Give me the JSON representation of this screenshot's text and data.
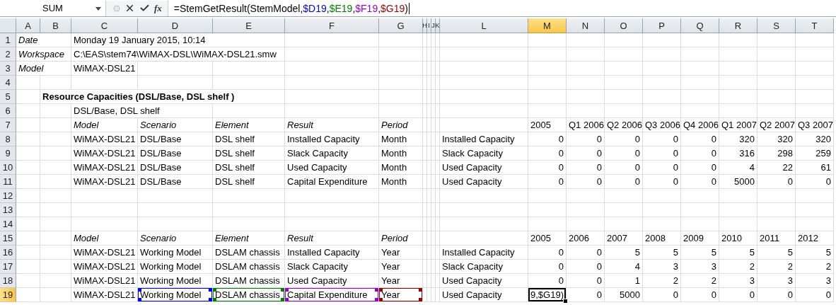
{
  "formula_bar": {
    "name_box": "SUM",
    "function_label": "fx",
    "formula": [
      {
        "text": "=StemGetResult(StemModel,"
      },
      {
        "text": "$D19",
        "color": "#0000ff"
      },
      {
        "text": ","
      },
      {
        "text": "$E19",
        "color": "#008000"
      },
      {
        "text": ","
      },
      {
        "text": "$F19",
        "color": "#9900cc"
      },
      {
        "text": ","
      },
      {
        "text": "$G19",
        "color": "#990000"
      },
      {
        "text": ")"
      }
    ]
  },
  "columns": [
    {
      "label": "A",
      "selected": false
    },
    {
      "label": "B",
      "selected": false
    },
    {
      "label": "C",
      "selected": false
    },
    {
      "label": "D",
      "selected": false
    },
    {
      "label": "E",
      "selected": false
    },
    {
      "label": "F",
      "selected": false
    },
    {
      "label": "G",
      "selected": false
    },
    {
      "label": "H",
      "selected": false
    },
    {
      "label": "I",
      "selected": false
    },
    {
      "label": "J",
      "selected": false
    },
    {
      "label": "K",
      "selected": false
    },
    {
      "label": "L",
      "selected": false
    },
    {
      "label": "M",
      "selected": true
    },
    {
      "label": "N",
      "selected": false
    },
    {
      "label": "O",
      "selected": false
    },
    {
      "label": "P",
      "selected": false
    },
    {
      "label": "Q",
      "selected": false
    },
    {
      "label": "R",
      "selected": false
    },
    {
      "label": "S",
      "selected": false
    },
    {
      "label": "T",
      "selected": false
    }
  ],
  "rows": [
    {
      "number": "1",
      "selected": false,
      "cells": {
        "A": {
          "text": "Date",
          "kind": "italic",
          "selected": false
        },
        "C": {
          "text": "Monday 19 January 2015, 10:14",
          "kind": "text",
          "selected": false
        }
      }
    },
    {
      "number": "2",
      "selected": false,
      "cells": {
        "A": {
          "text": "Workspace",
          "kind": "italic",
          "selected": false
        },
        "C": {
          "text": "C:\\EAS\\stem74\\WiMAX-DSL\\WiMAX-DSL21.smw",
          "kind": "text",
          "selected": false
        }
      }
    },
    {
      "number": "3",
      "selected": false,
      "cells": {
        "A": {
          "text": "Model",
          "kind": "italic",
          "selected": false
        },
        "C": {
          "text": "WiMAX-DSL21",
          "kind": "text",
          "selected": false
        }
      }
    },
    {
      "number": "4",
      "selected": false,
      "cells": {}
    },
    {
      "number": "5",
      "selected": false,
      "cells": {
        "B": {
          "text": "Resource Capacities (DSL/Base, DSL shelf )",
          "kind": "bold",
          "selected": false
        }
      }
    },
    {
      "number": "6",
      "selected": false,
      "cells": {
        "C": {
          "text": "DSL/Base, DSL shelf",
          "kind": "text",
          "selected": false
        }
      }
    },
    {
      "number": "7",
      "selected": false,
      "cells": {
        "C": {
          "text": "Model",
          "kind": "italic",
          "selected": false
        },
        "D": {
          "text": "Scenario",
          "kind": "italic",
          "selected": false
        },
        "E": {
          "text": "Element",
          "kind": "italic",
          "selected": false
        },
        "F": {
          "text": "Result",
          "kind": "italic",
          "selected": false
        },
        "G": {
          "text": "Period",
          "kind": "italic",
          "selected": false
        },
        "M": {
          "text": "2005",
          "kind": "text",
          "selected": false
        },
        "N": {
          "text": "Q1 2006",
          "kind": "text",
          "selected": false
        },
        "O": {
          "text": "Q2 2006",
          "kind": "text",
          "selected": false
        },
        "P": {
          "text": "Q3 2006",
          "kind": "text",
          "selected": false
        },
        "Q": {
          "text": "Q4 2006",
          "kind": "text",
          "selected": false
        },
        "R": {
          "text": "Q1 2007",
          "kind": "text",
          "selected": false
        },
        "S": {
          "text": "Q2 2007",
          "kind": "text",
          "selected": false
        },
        "T": {
          "text": "Q3 2007",
          "kind": "text",
          "selected": false
        }
      }
    },
    {
      "number": "8",
      "selected": false,
      "cells": {
        "C": {
          "text": "WiMAX-DSL21",
          "kind": "text",
          "selected": false
        },
        "D": {
          "text": "DSL/Base",
          "kind": "text",
          "selected": false
        },
        "E": {
          "text": "DSL shelf",
          "kind": "text",
          "selected": false
        },
        "F": {
          "text": "Installed Capacity",
          "kind": "text",
          "selected": false
        },
        "G": {
          "text": "Month",
          "kind": "text",
          "selected": false
        },
        "L": {
          "text": "Installed Capacity",
          "kind": "text",
          "selected": false
        },
        "M": {
          "text": "0",
          "kind": "number",
          "selected": false
        },
        "N": {
          "text": "0",
          "kind": "number",
          "selected": false
        },
        "O": {
          "text": "0",
          "kind": "number",
          "selected": false
        },
        "P": {
          "text": "0",
          "kind": "number",
          "selected": false
        },
        "Q": {
          "text": "0",
          "kind": "number",
          "selected": false
        },
        "R": {
          "text": "320",
          "kind": "number",
          "selected": false
        },
        "S": {
          "text": "320",
          "kind": "number",
          "selected": false
        },
        "T": {
          "text": "320",
          "kind": "number",
          "selected": false
        }
      }
    },
    {
      "number": "9",
      "selected": false,
      "cells": {
        "C": {
          "text": "WiMAX-DSL21",
          "kind": "text",
          "selected": false
        },
        "D": {
          "text": "DSL/Base",
          "kind": "text",
          "selected": false
        },
        "E": {
          "text": "DSL shelf",
          "kind": "text",
          "selected": false
        },
        "F": {
          "text": "Slack Capacity",
          "kind": "text",
          "selected": false
        },
        "G": {
          "text": "Month",
          "kind": "text",
          "selected": false
        },
        "L": {
          "text": "Slack Capacity",
          "kind": "text",
          "selected": false
        },
        "M": {
          "text": "0",
          "kind": "number",
          "selected": false
        },
        "N": {
          "text": "0",
          "kind": "number",
          "selected": false
        },
        "O": {
          "text": "0",
          "kind": "number",
          "selected": false
        },
        "P": {
          "text": "0",
          "kind": "number",
          "selected": false
        },
        "Q": {
          "text": "0",
          "kind": "number",
          "selected": false
        },
        "R": {
          "text": "316",
          "kind": "number",
          "selected": false
        },
        "S": {
          "text": "298",
          "kind": "number",
          "selected": false
        },
        "T": {
          "text": "259",
          "kind": "number",
          "selected": false
        }
      }
    },
    {
      "number": "10",
      "selected": false,
      "cells": {
        "C": {
          "text": "WiMAX-DSL21",
          "kind": "text",
          "selected": false
        },
        "D": {
          "text": "DSL/Base",
          "kind": "text",
          "selected": false
        },
        "E": {
          "text": "DSL shelf",
          "kind": "text",
          "selected": false
        },
        "F": {
          "text": "Used Capacity",
          "kind": "text",
          "selected": false
        },
        "G": {
          "text": "Month",
          "kind": "text",
          "selected": false
        },
        "L": {
          "text": "Used Capacity",
          "kind": "text",
          "selected": false
        },
        "M": {
          "text": "0",
          "kind": "number",
          "selected": false
        },
        "N": {
          "text": "0",
          "kind": "number",
          "selected": false
        },
        "O": {
          "text": "0",
          "kind": "number",
          "selected": false
        },
        "P": {
          "text": "0",
          "kind": "number",
          "selected": false
        },
        "Q": {
          "text": "0",
          "kind": "number",
          "selected": false
        },
        "R": {
          "text": "4",
          "kind": "number",
          "selected": false
        },
        "S": {
          "text": "22",
          "kind": "number",
          "selected": false
        },
        "T": {
          "text": "61",
          "kind": "number",
          "selected": false
        }
      }
    },
    {
      "number": "11",
      "selected": false,
      "cells": {
        "C": {
          "text": "WiMAX-DSL21",
          "kind": "text",
          "selected": false
        },
        "D": {
          "text": "DSL/Base",
          "kind": "text",
          "selected": false
        },
        "E": {
          "text": "DSL shelf",
          "kind": "text",
          "selected": false
        },
        "F": {
          "text": "Capital Expenditure",
          "kind": "text",
          "selected": false
        },
        "G": {
          "text": "Month",
          "kind": "text",
          "selected": false
        },
        "L": {
          "text": "Used Capacity",
          "kind": "text",
          "selected": false
        },
        "M": {
          "text": "0",
          "kind": "number",
          "selected": false
        },
        "N": {
          "text": "0",
          "kind": "number",
          "selected": false
        },
        "O": {
          "text": "0",
          "kind": "number",
          "selected": false
        },
        "P": {
          "text": "0",
          "kind": "number",
          "selected": false
        },
        "Q": {
          "text": "0",
          "kind": "number",
          "selected": false
        },
        "R": {
          "text": "5000",
          "kind": "number",
          "selected": false
        },
        "S": {
          "text": "0",
          "kind": "number",
          "selected": false
        },
        "T": {
          "text": "0",
          "kind": "number",
          "selected": false
        }
      }
    },
    {
      "number": "12",
      "selected": false,
      "cells": {}
    },
    {
      "number": "13",
      "selected": false,
      "cells": {}
    },
    {
      "number": "14",
      "selected": false,
      "cells": {}
    },
    {
      "number": "15",
      "selected": false,
      "cells": {
        "C": {
          "text": "Model",
          "kind": "italic",
          "selected": false
        },
        "D": {
          "text": "Scenario",
          "kind": "italic",
          "selected": false
        },
        "E": {
          "text": "Element",
          "kind": "italic",
          "selected": false
        },
        "F": {
          "text": "Result",
          "kind": "italic",
          "selected": false
        },
        "G": {
          "text": "Period",
          "kind": "italic",
          "selected": false
        },
        "M": {
          "text": "2005",
          "kind": "text",
          "selected": false
        },
        "N": {
          "text": "2006",
          "kind": "text",
          "selected": false
        },
        "O": {
          "text": "2007",
          "kind": "text",
          "selected": false
        },
        "P": {
          "text": "2008",
          "kind": "text",
          "selected": false
        },
        "Q": {
          "text": "2009",
          "kind": "text",
          "selected": false
        },
        "R": {
          "text": "2010",
          "kind": "text",
          "selected": false
        },
        "S": {
          "text": "2011",
          "kind": "text",
          "selected": false
        },
        "T": {
          "text": "2012",
          "kind": "text",
          "selected": false
        }
      }
    },
    {
      "number": "16",
      "selected": false,
      "cells": {
        "C": {
          "text": "WiMAX-DSL21",
          "kind": "text",
          "selected": false
        },
        "D": {
          "text": "Working Model",
          "kind": "text",
          "selected": false
        },
        "E": {
          "text": "DSLAM chassis",
          "kind": "text",
          "selected": false
        },
        "F": {
          "text": "Installed Capacity",
          "kind": "text",
          "selected": false
        },
        "G": {
          "text": "Year",
          "kind": "text",
          "selected": false
        },
        "L": {
          "text": "Installed Capacity",
          "kind": "text",
          "selected": false
        },
        "M": {
          "text": "0",
          "kind": "number",
          "selected": false
        },
        "N": {
          "text": "0",
          "kind": "number",
          "selected": false
        },
        "O": {
          "text": "5",
          "kind": "number",
          "selected": false
        },
        "P": {
          "text": "5",
          "kind": "number",
          "selected": false
        },
        "Q": {
          "text": "5",
          "kind": "number",
          "selected": false
        },
        "R": {
          "text": "5",
          "kind": "number",
          "selected": false
        },
        "S": {
          "text": "5",
          "kind": "number",
          "selected": false
        },
        "T": {
          "text": "5",
          "kind": "number",
          "selected": false
        }
      }
    },
    {
      "number": "17",
      "selected": false,
      "cells": {
        "C": {
          "text": "WiMAX-DSL21",
          "kind": "text",
          "selected": false
        },
        "D": {
          "text": "Working Model",
          "kind": "text",
          "selected": false
        },
        "E": {
          "text": "DSLAM chassis",
          "kind": "text",
          "selected": false
        },
        "F": {
          "text": "Slack Capacity",
          "kind": "text",
          "selected": false
        },
        "G": {
          "text": "Year",
          "kind": "text",
          "selected": false
        },
        "L": {
          "text": "Slack Capacity",
          "kind": "text",
          "selected": false
        },
        "M": {
          "text": "0",
          "kind": "number",
          "selected": false
        },
        "N": {
          "text": "0",
          "kind": "number",
          "selected": false
        },
        "O": {
          "text": "4",
          "kind": "number",
          "selected": false
        },
        "P": {
          "text": "3",
          "kind": "number",
          "selected": false
        },
        "Q": {
          "text": "3",
          "kind": "number",
          "selected": false
        },
        "R": {
          "text": "2",
          "kind": "number",
          "selected": false
        },
        "S": {
          "text": "2",
          "kind": "number",
          "selected": false
        },
        "T": {
          "text": "2",
          "kind": "number",
          "selected": false
        }
      }
    },
    {
      "number": "18",
      "selected": false,
      "cells": {
        "C": {
          "text": "WiMAX-DSL21",
          "kind": "text",
          "selected": false
        },
        "D": {
          "text": "Working Model",
          "kind": "text",
          "selected": false
        },
        "E": {
          "text": "DSLAM chassis",
          "kind": "text",
          "selected": false
        },
        "F": {
          "text": "Used Capacity",
          "kind": "text",
          "selected": false
        },
        "G": {
          "text": "Year",
          "kind": "text",
          "selected": false
        },
        "L": {
          "text": "Used Capacity",
          "kind": "text",
          "selected": false
        },
        "M": {
          "text": "0",
          "kind": "number",
          "selected": false
        },
        "N": {
          "text": "0",
          "kind": "number",
          "selected": false
        },
        "O": {
          "text": "1",
          "kind": "number",
          "selected": false
        },
        "P": {
          "text": "2",
          "kind": "number",
          "selected": false
        },
        "Q": {
          "text": "2",
          "kind": "number",
          "selected": false
        },
        "R": {
          "text": "3",
          "kind": "number",
          "selected": false
        },
        "S": {
          "text": "3",
          "kind": "number",
          "selected": false
        },
        "T": {
          "text": "3",
          "kind": "number",
          "selected": false
        }
      }
    },
    {
      "number": "19",
      "selected": true,
      "cells": {
        "C": {
          "text": "WiMAX-DSL21",
          "kind": "text",
          "selected": false
        },
        "D": {
          "text": "Working Model",
          "kind": "text",
          "selected": false,
          "color": "#0000ff"
        },
        "E": {
          "text": "DSLAM chassis",
          "kind": "text",
          "selected": false,
          "color": "#008000"
        },
        "F": {
          "text": "Capital Expenditure",
          "kind": "text",
          "selected": false,
          "color": "#9900cc"
        },
        "G": {
          "text": "Year",
          "kind": "text",
          "selected": false,
          "color": "#990000"
        },
        "L": {
          "text": "Used Capacity",
          "kind": "text",
          "selected": false
        },
        "M": {
          "text": "9,$G19)",
          "kind": "text",
          "selected": true
        },
        "N": {
          "text": "0",
          "kind": "number",
          "selected": false
        },
        "O": {
          "text": "5000",
          "kind": "number",
          "selected": false
        },
        "P": {
          "text": "0",
          "kind": "number",
          "selected": false
        },
        "Q": {
          "text": "0",
          "kind": "number",
          "selected": false
        },
        "R": {
          "text": "0",
          "kind": "number",
          "selected": false
        },
        "S": {
          "text": "0",
          "kind": "number",
          "selected": false
        },
        "T": {
          "text": "0",
          "kind": "number",
          "selected": false
        }
      }
    }
  ]
}
